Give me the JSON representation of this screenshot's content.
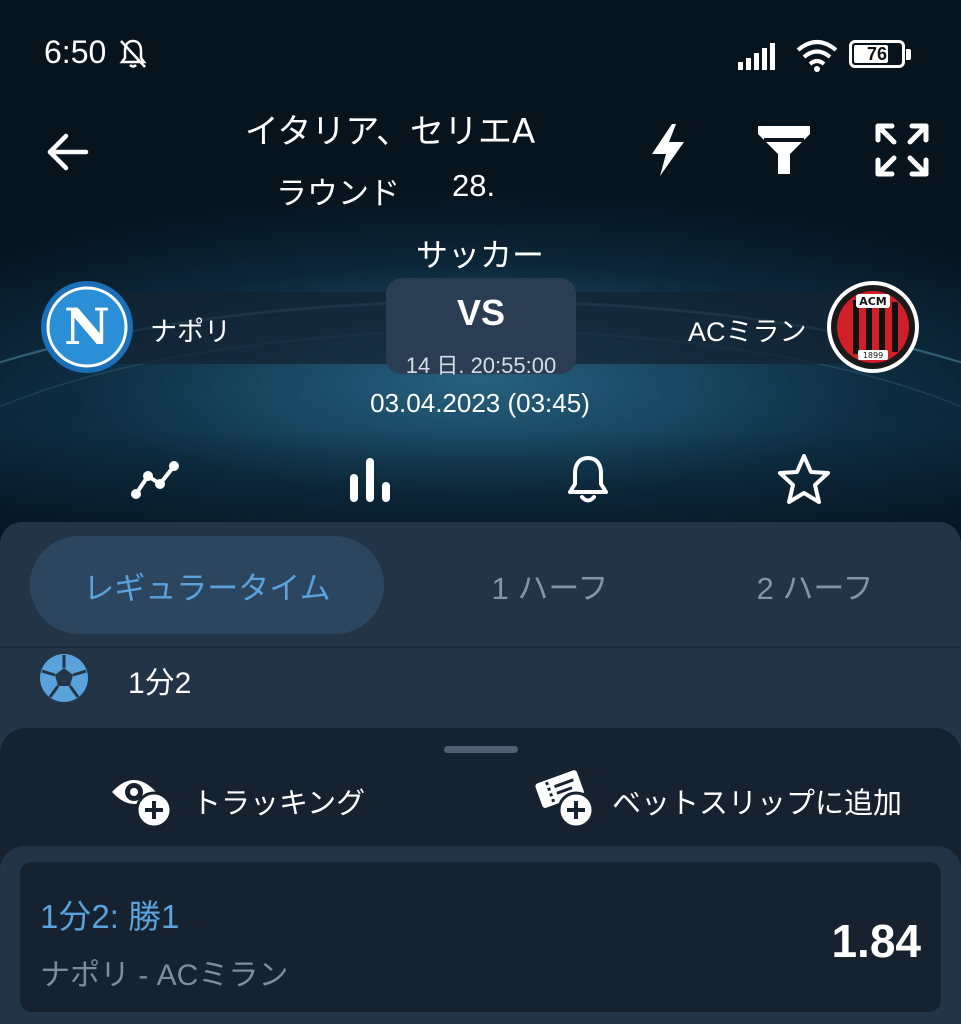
{
  "status_bar": {
    "time": "6:50",
    "battery": "76",
    "battery_level_pct": 76
  },
  "header": {
    "league": "イタリア、セリエA",
    "round_label": "ラウンド",
    "round_number": "28.",
    "sport": "サッカー"
  },
  "match": {
    "home_team": "ナポリ",
    "away_team": "ACミラン",
    "vs": "VS",
    "countdown": "14 日. 20:55:00",
    "datetime": "03.04.2023 (03:45)"
  },
  "tabs": [
    {
      "label": "レギュラータイム",
      "active": true
    },
    {
      "label": "1 ハーフ",
      "active": false
    },
    {
      "label": "2 ハーフ",
      "active": false
    }
  ],
  "market": {
    "name": "1分2"
  },
  "sheet": {
    "tracking_label": "トラッキング",
    "add_to_slip_label": "ベットスリップに追加"
  },
  "bet": {
    "title": "1分2: 勝1",
    "teams": "ナポリ - ACミラン",
    "odds": "1.84"
  },
  "icons": {
    "back": "back-arrow-icon",
    "quick": "lightning-icon",
    "filter": "filter-icon",
    "expand": "expand-icon",
    "stats_line": "line-chart-icon",
    "stats_bar": "bar-chart-icon",
    "notification": "bell-icon",
    "favorite": "star-icon",
    "market": "soccer-ball-icon",
    "tracking": "eye-plus-icon",
    "slip": "ticket-plus-icon"
  },
  "colors": {
    "accent": "#5aa2dc",
    "panel": "#223446",
    "sheet": "#16222f",
    "away_red": "#d11f2a",
    "home_blue": "#2a8fd6"
  }
}
